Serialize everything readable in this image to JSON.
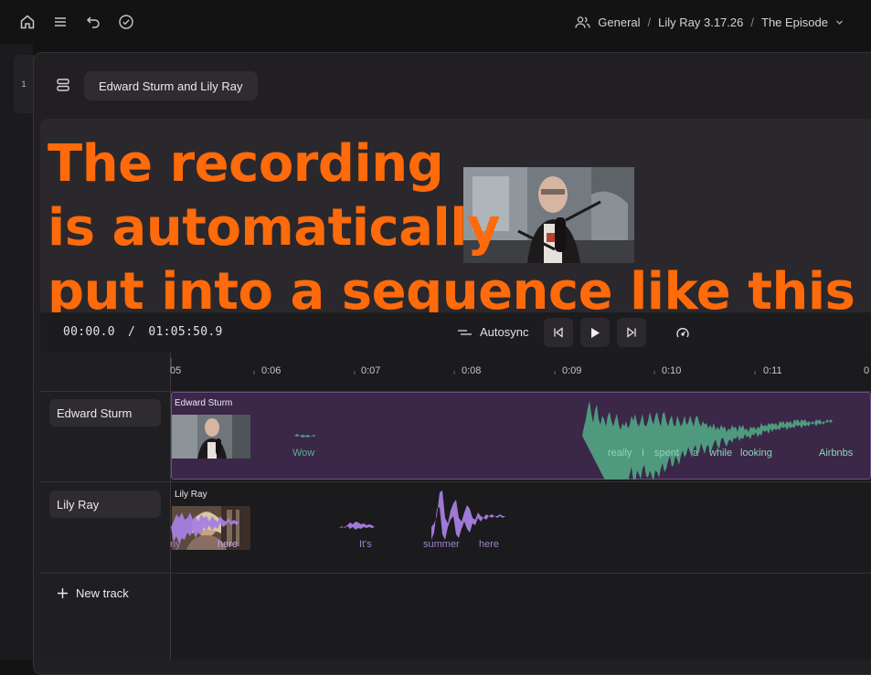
{
  "topbar": {
    "icons": [
      "home-icon",
      "menu-icon",
      "undo-icon",
      "check-circle-icon"
    ],
    "breadcrumb": {
      "workspace": "General",
      "project": "Lily Ray 3.17.26",
      "composition": "The Episode"
    }
  },
  "rail": {
    "page_number": "1"
  },
  "sequence": {
    "title": "Edward Sturm and Lily Ray"
  },
  "caption": {
    "line1": "The recording",
    "line2": "is automatically",
    "line3": "put into a sequence like this"
  },
  "transport": {
    "current_time": "00:00.0",
    "separator": "/",
    "duration": "01:05:50.9",
    "autosync_label": "Autosync"
  },
  "ruler": {
    "ticks": [
      "05",
      "0:06",
      "0:07",
      "0:08",
      "0:09",
      "0:10",
      "0:11",
      "0"
    ]
  },
  "tracks": [
    {
      "name": "Edward Sturm",
      "clip_title": "Edward Sturm",
      "words": [
        "Wow",
        "really",
        "I",
        "spent",
        "a",
        "while",
        "looking",
        "Airbnbs"
      ]
    },
    {
      "name": "Lily Ray",
      "clip_title": "Lily Ray",
      "words": [
        "ny",
        "here",
        "It's",
        "summer",
        "here"
      ]
    }
  ],
  "new_track_label": "New track",
  "colors": {
    "caption": "#ff6a0a",
    "edward_wave": "#4f9a7e",
    "lily_wave": "#a77fe0",
    "edward_clip_bg": "#3b2748"
  }
}
